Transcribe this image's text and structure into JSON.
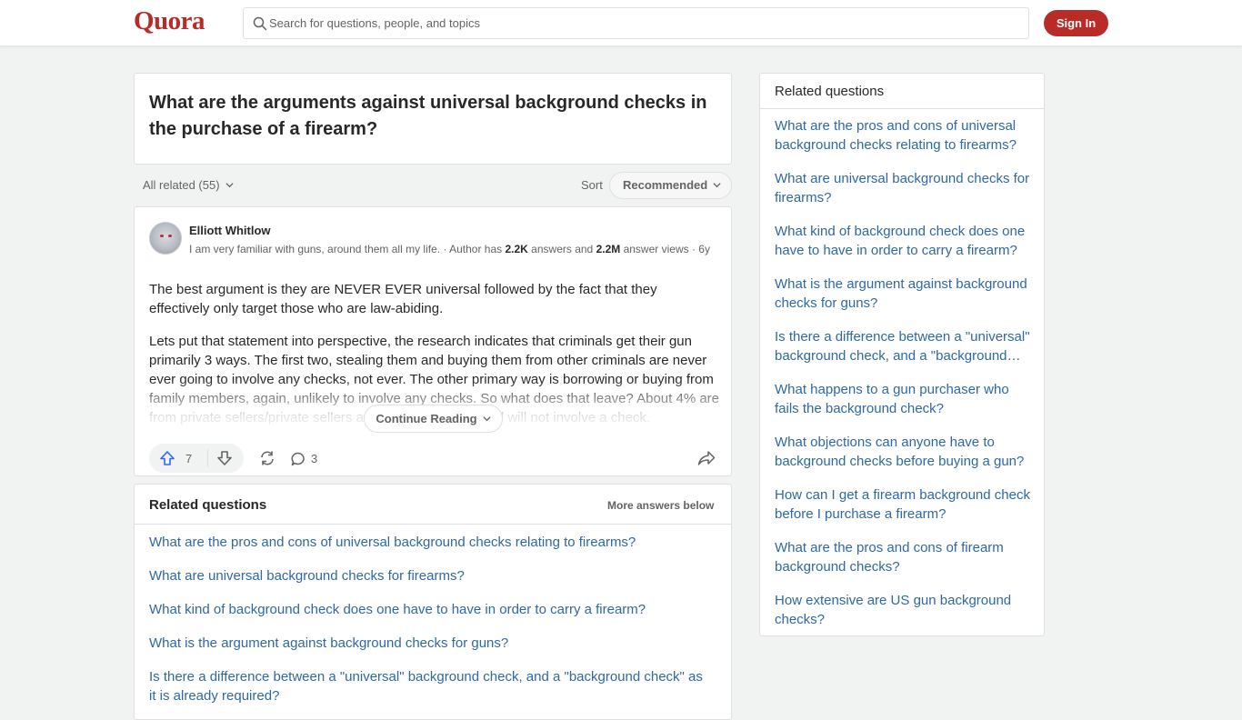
{
  "header": {
    "logo": "Quora",
    "search_placeholder": "Search for questions, people, and topics",
    "sign_in_label": "Sign In"
  },
  "question": {
    "title": "What are the arguments against universal background checks in the purchase of a firearm?"
  },
  "filters": {
    "all_related": "All related (55)",
    "sort_label": "Sort",
    "sort_value": "Recommended"
  },
  "answer": {
    "author_name": "Elliott Whitlow",
    "credential": "I am very familiar with guns, around them all my life.",
    "stats_prefix": " · Author has ",
    "answers_count": "2.2K",
    "answers_mid": " answers and ",
    "views_count": "2.2M",
    "views_suffix": " answer views · 6y",
    "paragraph_1": "The best argument is they are NEVER EVER universal followed by the fact that they effectively only target those who are law-abiding.",
    "paragraph_2": "Lets put that statement into perspective, the research indicates that criminals get their gun primarily 3 ways. The first two, stealing them and buying them from other criminals are never ever going to involve any checks, not ever. The other primary way is borrowing or buying from family members, again, unlikely to involve any checks. So what does that leave? About 4% are from private sellers/private sellers at gun shows, in general will not involve a check.",
    "continue_label": "Continue Reading",
    "upvotes": "7",
    "comments": "3"
  },
  "related_main": {
    "title": "Related questions",
    "more_label": "More answers below",
    "items": [
      "What are the pros and cons of universal background checks relating to firearms?",
      "What are universal background checks for firearms?",
      "What kind of background check does one have to have in order to carry a firearm?",
      "What is the argument against background checks for guns?",
      "Is there a difference between a \"universal\" background check, and a \"background check\" as it is already required?"
    ]
  },
  "related_side": {
    "title": "Related questions",
    "items": [
      "What are the pros and cons of universal background checks relating to firearms?",
      "What are universal background checks for firearms?",
      "What kind of background check does one have to have in order to carry a firearm?",
      "What is the argument against background checks for guns?",
      "Is there a difference between a \"universal\" background check, and a \"background…",
      "What happens to a gun purchaser who fails the background check?",
      "What objections can anyone have to background checks before buying a gun?",
      "How can I get a firearm background check before I purchase a firearm?",
      "What are the pros and cons of firearm background checks?",
      "How extensive are US gun background checks?"
    ]
  },
  "icons": {
    "search": "search-icon",
    "upvote": "upvote-arrow-icon",
    "downvote": "downvote-arrow-icon",
    "reshare": "reshare-icon",
    "comment": "comment-bubble-icon",
    "share": "share-forward-icon",
    "chevron": "chevron-down-icon"
  },
  "colors": {
    "brand": "#b92b27",
    "link": "#2e69a3",
    "upvote": "#2e69ff",
    "background": "#f1f2f2"
  }
}
